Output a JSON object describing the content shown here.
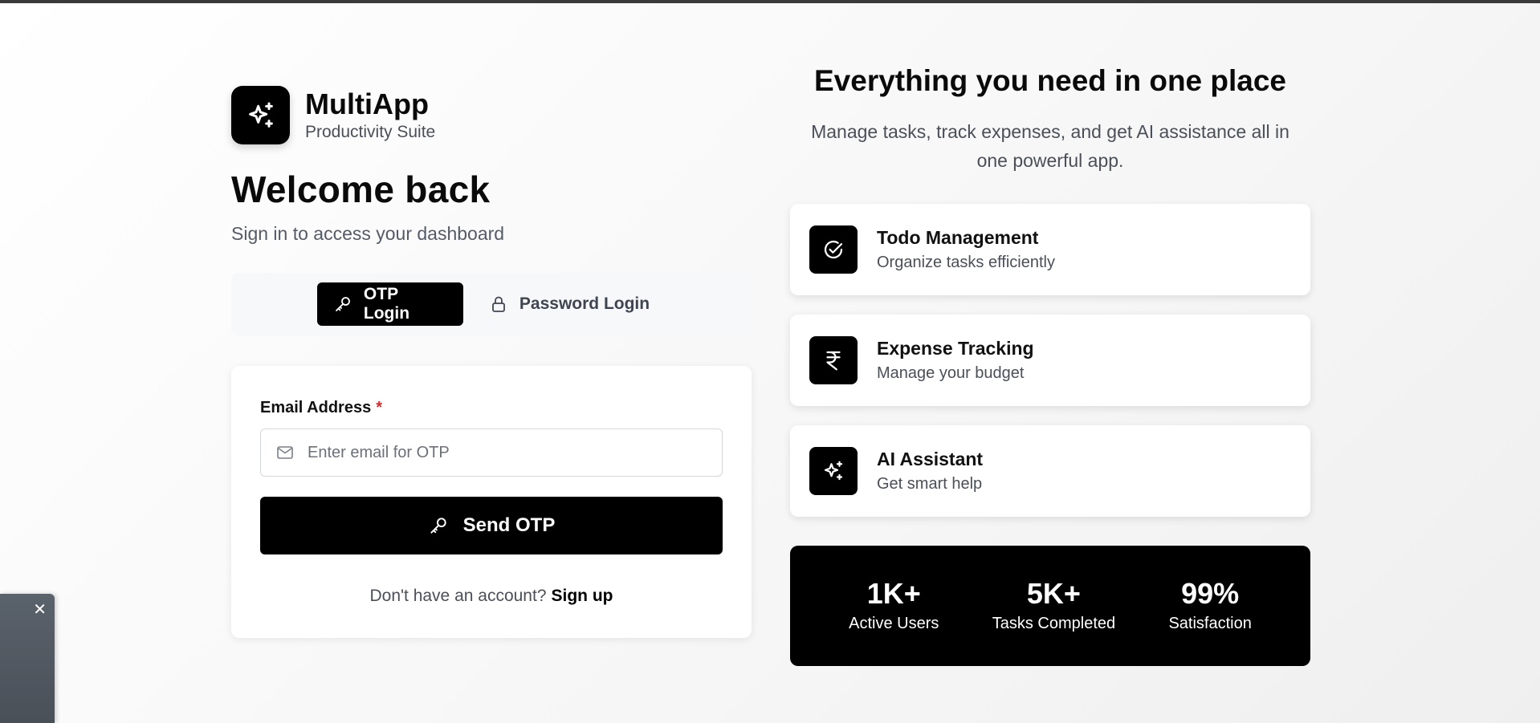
{
  "brand": {
    "name": "MultiApp",
    "subtitle": "Productivity Suite"
  },
  "login": {
    "heading": "Welcome back",
    "subheading": "Sign in to access your dashboard",
    "tabs": [
      {
        "label": "OTP Login",
        "icon": "key-icon",
        "active": true
      },
      {
        "label": "Password Login",
        "icon": "lock-icon",
        "active": false
      }
    ],
    "form": {
      "email_label": "Email Address",
      "required_mark": "*",
      "email_placeholder": "Enter email for OTP",
      "email_value": "",
      "submit_label": "Send OTP"
    },
    "signup": {
      "prompt": "Don't have an account?",
      "link_label": "Sign up"
    }
  },
  "hero": {
    "title": "Everything you need in one place",
    "subtitle": "Manage tasks, track expenses, and get AI assistance all in one powerful app."
  },
  "features": [
    {
      "title": "Todo Management",
      "description": "Organize tasks efficiently",
      "icon": "check-circle-icon"
    },
    {
      "title": "Expense Tracking",
      "description": "Manage your budget",
      "icon": "rupee-icon"
    },
    {
      "title": "AI Assistant",
      "description": "Get smart help",
      "icon": "sparkles-icon"
    }
  ],
  "stats": [
    {
      "value": "1K+",
      "label": "Active Users"
    },
    {
      "value": "5K+",
      "label": "Tasks Completed"
    },
    {
      "value": "99%",
      "label": "Satisfaction"
    }
  ],
  "widget": {
    "close_label": "✕"
  },
  "colors": {
    "primary": "#000000",
    "required": "#dc2626",
    "muted_text": "#4a4f58",
    "tab_bg": "#f7f8fa"
  }
}
